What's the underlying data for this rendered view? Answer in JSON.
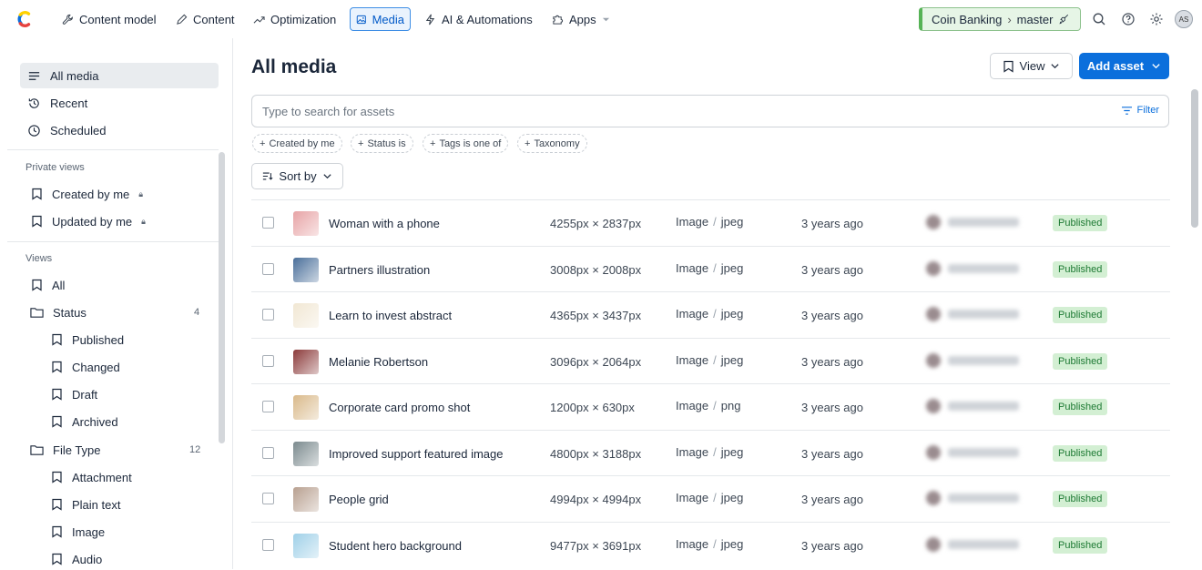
{
  "nav": {
    "items": [
      {
        "label": "Content model",
        "icon": "wrench-icon"
      },
      {
        "label": "Content",
        "icon": "pen-icon"
      },
      {
        "label": "Optimization",
        "icon": "trend-icon"
      },
      {
        "label": "Media",
        "icon": "image-icon"
      },
      {
        "label": "AI & Automations",
        "icon": "bolt-icon"
      },
      {
        "label": "Apps",
        "icon": "puzzle-icon"
      }
    ],
    "space": "Coin Banking",
    "environment": "master",
    "avatar_initials": "AS",
    "accent": "#0b6fdc"
  },
  "sidebar": {
    "top": [
      "All media",
      "Recent",
      "Scheduled"
    ],
    "private_heading": "Private views",
    "private": [
      "Created by me",
      "Updated by me"
    ],
    "views_heading": "Views",
    "all": "All",
    "status_folder": "Status",
    "status_count": "4",
    "status_items": [
      "Published",
      "Changed",
      "Draft",
      "Archived"
    ],
    "filetype_folder": "File Type",
    "filetype_count": "12",
    "filetype_items": [
      "Attachment",
      "Plain text",
      "Image",
      "Audio"
    ]
  },
  "main": {
    "title": "All media",
    "view_label": "View",
    "add_label": "Add asset",
    "search_placeholder": "Type to search for assets",
    "filter_label": "Filter",
    "chips": [
      "Created by me",
      "Status is",
      "Tags is one of",
      "Taxonomy"
    ],
    "sort_label": "Sort by"
  },
  "assets": [
    {
      "title": "Woman with a phone",
      "dims": "4255px × 2837px",
      "kind": "Image",
      "ext": "jpeg",
      "updated": "3 years ago",
      "status": "Published",
      "thumb": "#e7a3a5"
    },
    {
      "title": "Partners illustration",
      "dims": "3008px × 2008px",
      "kind": "Image",
      "ext": "jpeg",
      "updated": "3 years ago",
      "status": "Published",
      "thumb": "#4a6f9a"
    },
    {
      "title": "Learn to invest abstract",
      "dims": "4365px × 3437px",
      "kind": "Image",
      "ext": "jpeg",
      "updated": "3 years ago",
      "status": "Published",
      "thumb": "#f1e7d3"
    },
    {
      "title": "Melanie Robertson",
      "dims": "3096px × 2064px",
      "kind": "Image",
      "ext": "jpeg",
      "updated": "3 years ago",
      "status": "Published",
      "thumb": "#8b3a3a"
    },
    {
      "title": "Corporate card promo shot",
      "dims": "1200px × 630px",
      "kind": "Image",
      "ext": "png",
      "updated": "3 years ago",
      "status": "Published",
      "thumb": "#d9b98a"
    },
    {
      "title": "Improved support featured image",
      "dims": "4800px × 3188px",
      "kind": "Image",
      "ext": "jpeg",
      "updated": "3 years ago",
      "status": "Published",
      "thumb": "#7b8a8e"
    },
    {
      "title": "People grid",
      "dims": "4994px × 4994px",
      "kind": "Image",
      "ext": "jpeg",
      "updated": "3 years ago",
      "status": "Published",
      "thumb": "#b8a090"
    },
    {
      "title": "Student hero background",
      "dims": "9477px × 3691px",
      "kind": "Image",
      "ext": "jpeg",
      "updated": "3 years ago",
      "status": "Published",
      "thumb": "#9fd0e8"
    }
  ]
}
